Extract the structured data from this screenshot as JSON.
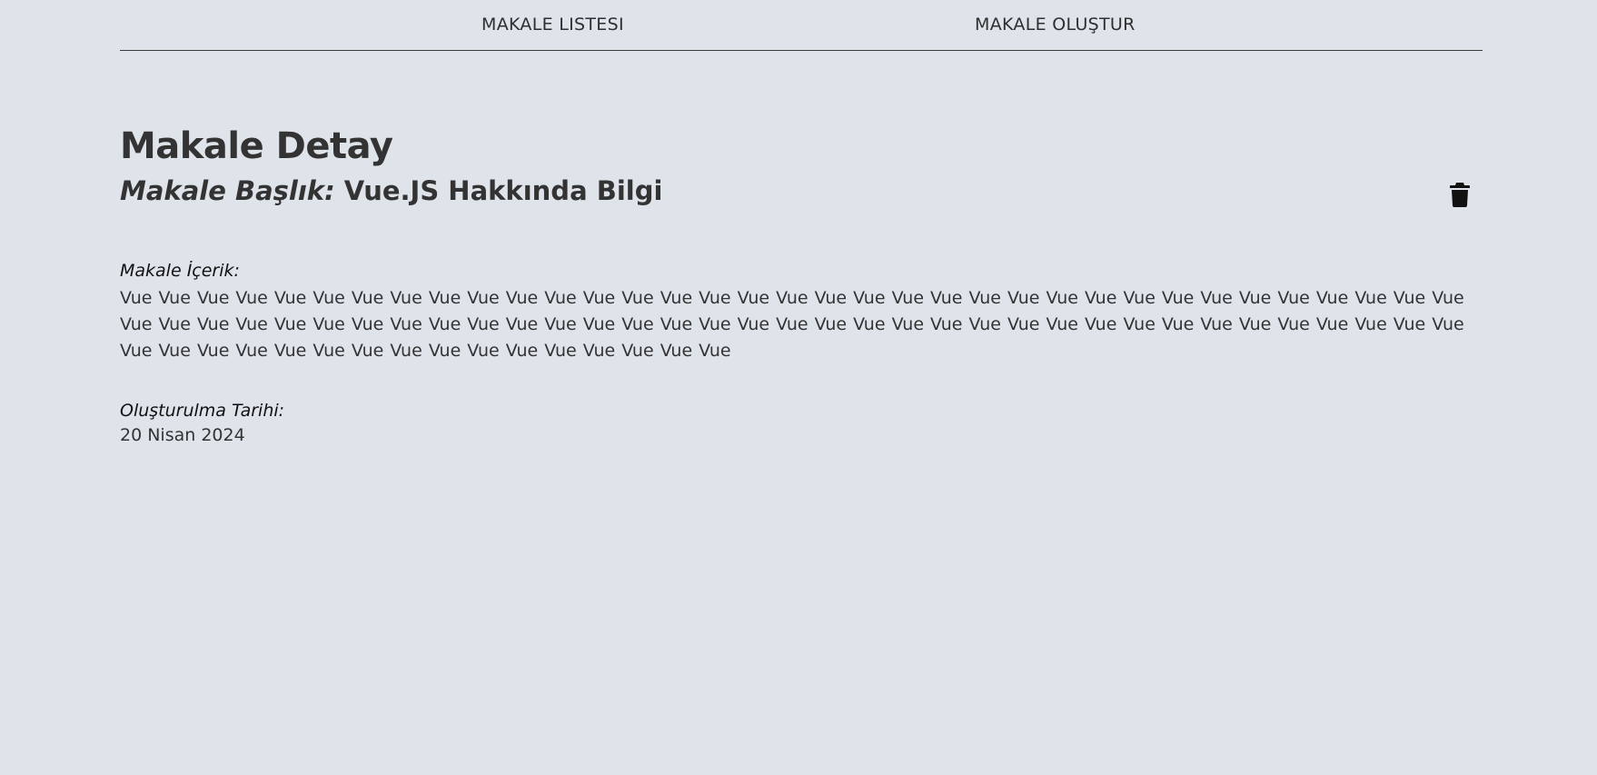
{
  "nav": {
    "list_label": "MAKALE LISTESI",
    "create_label": "MAKALE OLUŞTUR"
  },
  "page": {
    "title": "Makale Detay"
  },
  "article": {
    "title_label": "Makale Başlık:",
    "title_value": "Vue.JS Hakkında Bilgi",
    "content_label": "Makale İçerik:",
    "content_value": "Vue Vue Vue Vue Vue Vue Vue Vue Vue Vue Vue Vue Vue Vue Vue Vue Vue Vue Vue Vue Vue Vue Vue Vue Vue Vue Vue Vue Vue Vue Vue Vue Vue Vue Vue Vue Vue Vue Vue Vue Vue Vue Vue Vue Vue Vue Vue Vue Vue Vue Vue Vue Vue Vue Vue Vue Vue Vue Vue Vue Vue Vue Vue Vue Vue Vue Vue Vue Vue Vue Vue Vue Vue Vue Vue Vue Vue Vue Vue Vue Vue Vue Vue Vue Vue Vue",
    "date_label": "Oluşturulma Tarihi:",
    "date_value": "20 Nisan 2024"
  },
  "icons": {
    "delete": "trash-icon"
  },
  "colors": {
    "background": "#dfe4eb",
    "text": "#333333",
    "divider": "#3b3b3b"
  }
}
